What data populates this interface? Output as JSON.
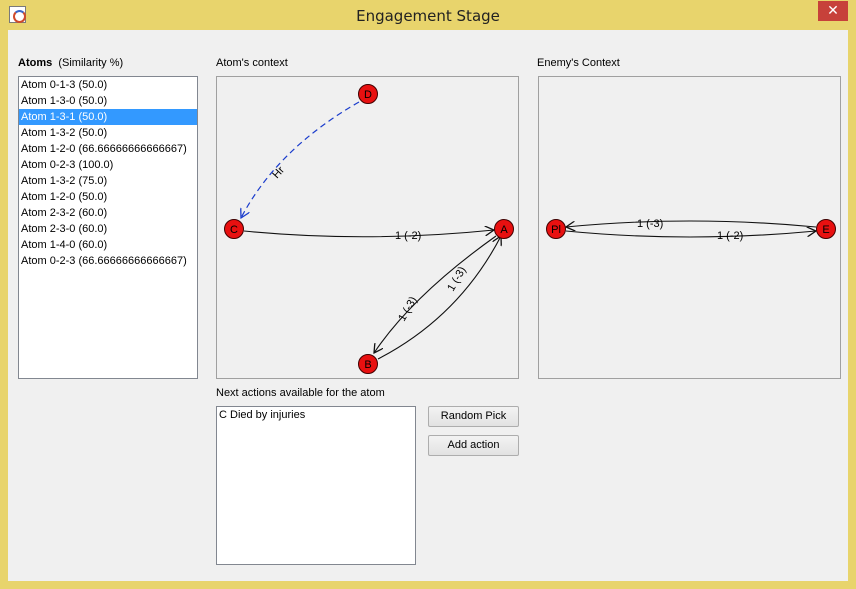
{
  "window": {
    "title": "Engagement Stage",
    "close_glyph": "✕"
  },
  "atoms": {
    "heading": "Atoms",
    "subheading": "(Similarity %)",
    "items": [
      "Atom 0-1-3 (50.0)",
      "Atom 1-3-0 (50.0)",
      "Atom 1-3-1 (50.0)",
      "Atom 1-3-2 (50.0)",
      "Atom 1-2-0 (66.66666666666667)",
      "Atom 0-2-3 (100.0)",
      "Atom 1-3-2 (75.0)",
      "Atom 1-2-0 (50.0)",
      "Atom 2-3-2 (60.0)",
      "Atom 2-3-0 (60.0)",
      "Atom 1-4-0 (60.0)",
      "Atom 0-2-3 (66.66666666666667)"
    ],
    "selected_index": 2
  },
  "atom_context": {
    "label": "Atom's context",
    "nodes": [
      "D",
      "C",
      "A",
      "B"
    ],
    "edges": [
      {
        "from": "D",
        "to": "C",
        "label": "Hr",
        "style": "dashed"
      },
      {
        "from": "C",
        "to": "A",
        "label": "1 (-2)",
        "style": "solid"
      },
      {
        "from": "A",
        "to": "B",
        "label": "1 (-3)",
        "style": "solid"
      },
      {
        "from": "B",
        "to": "A",
        "label": "1 (-3)",
        "style": "solid"
      }
    ]
  },
  "enemy_context": {
    "label": "Enemy's Context",
    "nodes": [
      "Pl",
      "E"
    ],
    "edges": [
      {
        "from": "E",
        "to": "Pl",
        "label": "1 (-3)",
        "style": "solid"
      },
      {
        "from": "Pl",
        "to": "E",
        "label": "1 (-2)",
        "style": "solid"
      }
    ]
  },
  "next_actions": {
    "label": "Next actions available for the atom",
    "items": [
      "C Died by injuries"
    ]
  },
  "buttons": {
    "random_pick": "Random Pick",
    "add_action": "Add action"
  },
  "colors": {
    "node_fill": "#e81010",
    "dashed_edge": "#1a3ccc",
    "selection": "#3399ff"
  },
  "icons": {
    "window": "java-app-icon",
    "close": "close-icon"
  }
}
